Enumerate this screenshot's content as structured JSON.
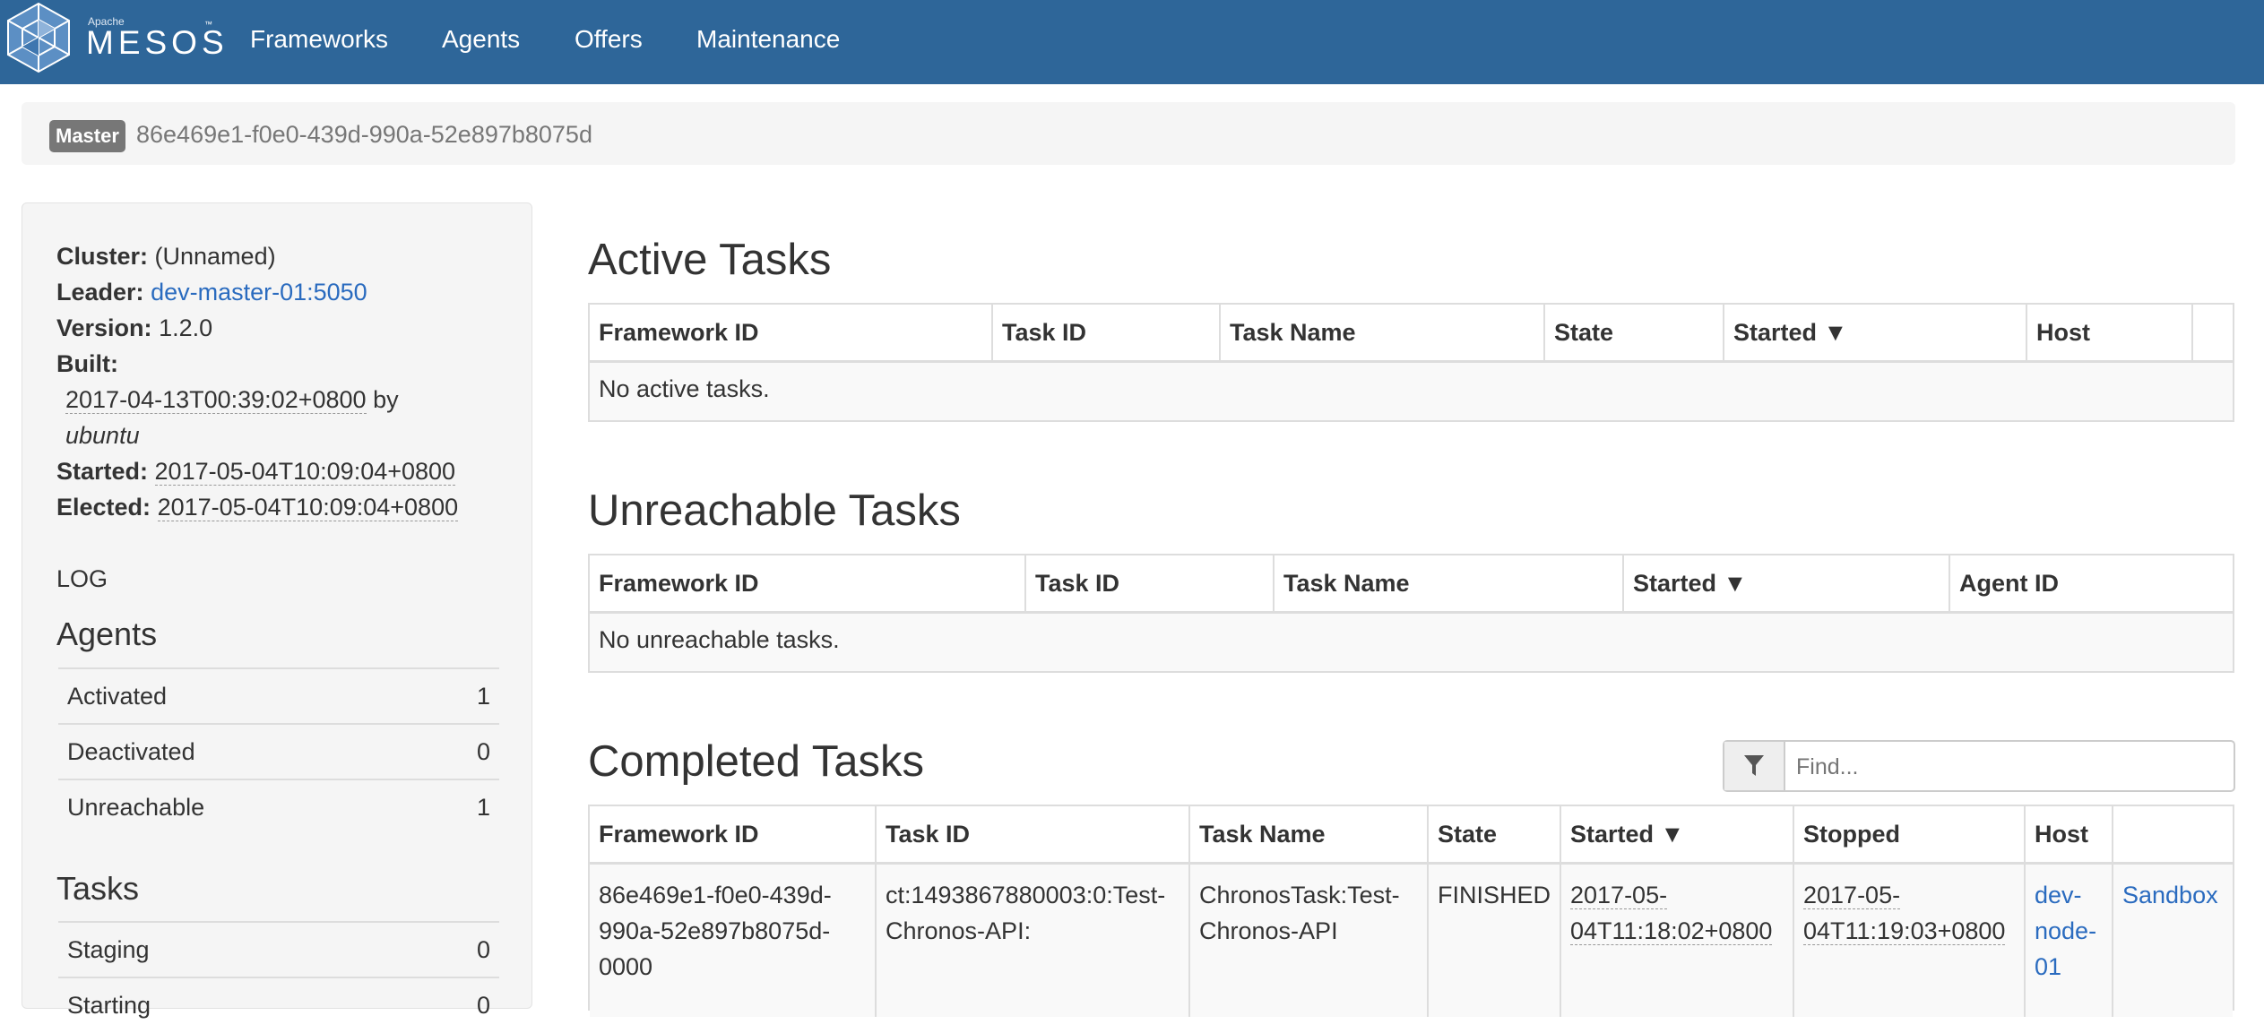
{
  "brand": {
    "small": "Apache",
    "name": "MESOS",
    "tm": "™"
  },
  "nav": [
    "Frameworks",
    "Agents",
    "Offers",
    "Maintenance"
  ],
  "master": {
    "label": "Master",
    "id": "86e469e1-f0e0-439d-990a-52e897b8075d"
  },
  "sidebar": {
    "cluster_label": "Cluster:",
    "cluster": "(Unnamed)",
    "leader_label": "Leader:",
    "leader": "dev-master-01:5050",
    "version_label": "Version:",
    "version": "1.2.0",
    "built_label": "Built:",
    "built_date": "2017-04-13T00:39:02+0800",
    "built_by_word": "by",
    "built_by": "ubuntu",
    "started_label": "Started:",
    "started": "2017-05-04T10:09:04+0800",
    "elected_label": "Elected:",
    "elected": "2017-05-04T10:09:04+0800",
    "log_link": "LOG",
    "agents_heading": "Agents",
    "agents": [
      {
        "label": "Activated",
        "value": "1"
      },
      {
        "label": "Deactivated",
        "value": "0"
      },
      {
        "label": "Unreachable",
        "value": "1"
      }
    ],
    "tasks_heading": "Tasks",
    "tasks": [
      {
        "label": "Staging",
        "value": "0"
      },
      {
        "label": "Starting",
        "value": "0"
      }
    ]
  },
  "active": {
    "title": "Active Tasks",
    "columns": [
      "Framework ID",
      "Task ID",
      "Task Name",
      "State",
      "Started ▼",
      "Host"
    ],
    "empty": "No active tasks."
  },
  "unreachable": {
    "title": "Unreachable Tasks",
    "columns": [
      "Framework ID",
      "Task ID",
      "Task Name",
      "Started ▼",
      "Agent ID"
    ],
    "empty": "No unreachable tasks."
  },
  "completed": {
    "title": "Completed Tasks",
    "search_placeholder": "Find...",
    "columns": [
      "Framework ID",
      "Task ID",
      "Task Name",
      "State",
      "Started ▼",
      "Stopped",
      "Host",
      ""
    ],
    "rows": [
      {
        "framework_id": "86e469e1-f0e0-439d-990a-52e897b8075d-0000",
        "task_id": "ct:1493867880003:0:Test-Chronos-API:",
        "task_name": "ChronosTask:Test-Chronos-API",
        "state": "FINISHED",
        "started": "2017-05-04T11:18:02+0800",
        "stopped": "2017-05-04T11:19:03+0800",
        "host": "dev-node-01",
        "sandbox": "Sandbox"
      }
    ]
  },
  "colors": {
    "navbar": "#2e6699",
    "link": "#2a6bbf",
    "label_bg": "#777777"
  }
}
